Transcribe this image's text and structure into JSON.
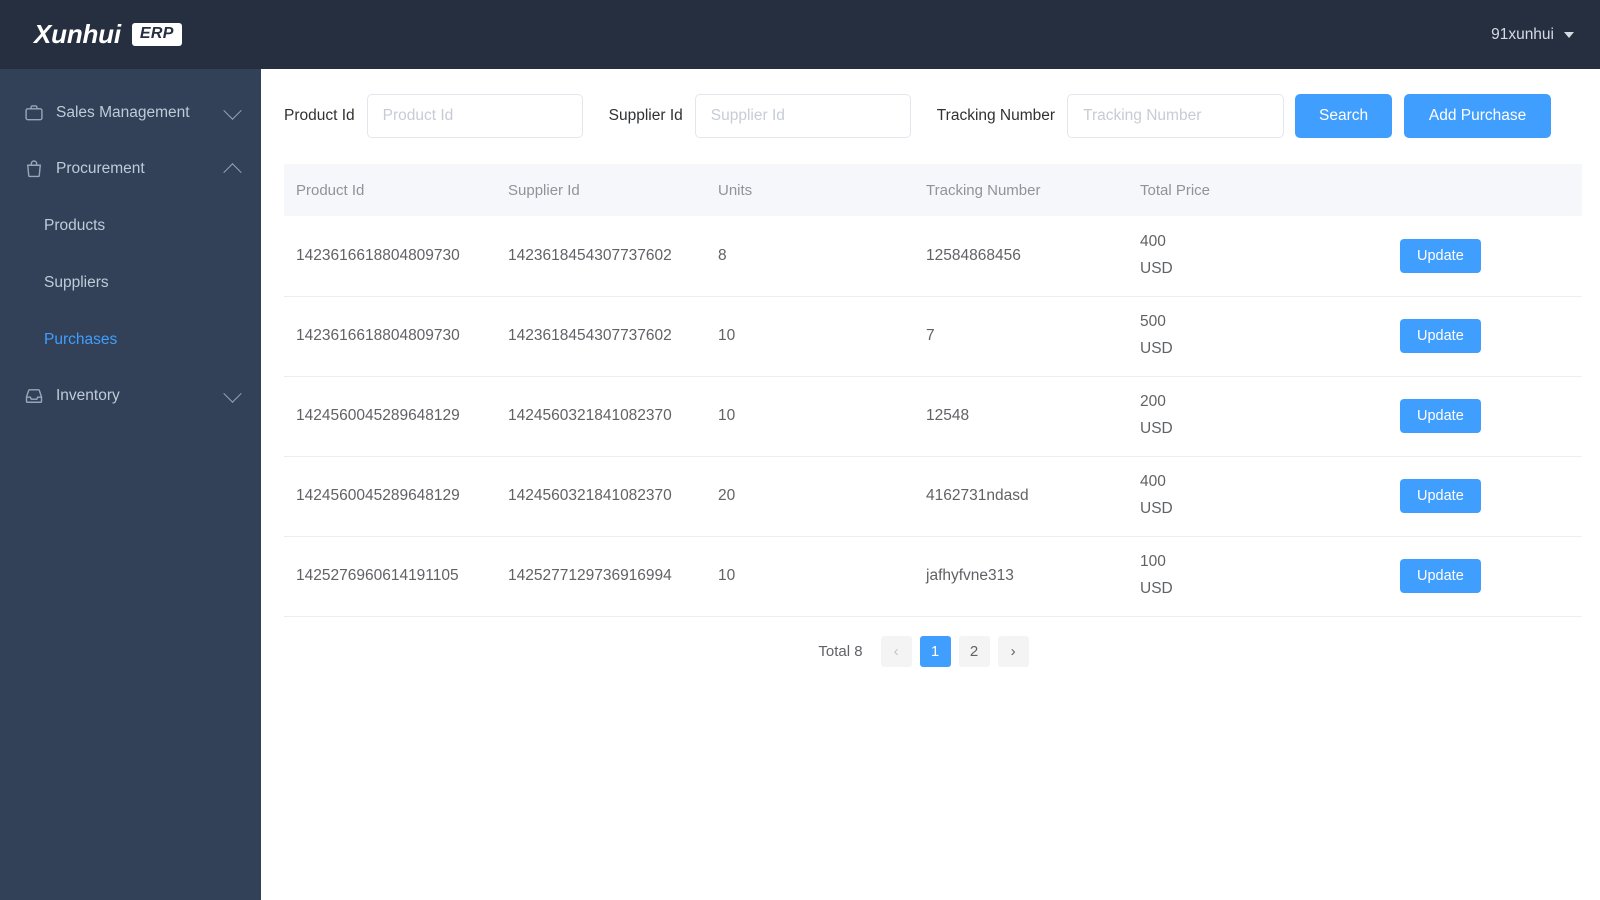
{
  "app": {
    "brand_name": "Xunhui",
    "brand_badge": "ERP",
    "accent_color": "#409eff",
    "topbar_color": "#262f40",
    "sidebar_color": "#324157"
  },
  "header": {
    "user_name": "91xunhui"
  },
  "sidebar": {
    "groups": [
      {
        "label": "Sales Management",
        "icon": "briefcase-icon",
        "expanded": false,
        "chevron": "chevron-down-icon"
      },
      {
        "label": "Procurement",
        "icon": "shopping-bag-icon",
        "expanded": true,
        "chevron": "chevron-up-icon"
      },
      {
        "label": "Inventory",
        "icon": "inbox-icon",
        "expanded": false,
        "chevron": "chevron-down-icon"
      }
    ],
    "procurement_items": [
      {
        "label": "Products",
        "active": false
      },
      {
        "label": "Suppliers",
        "active": false
      },
      {
        "label": "Purchases",
        "active": true
      }
    ]
  },
  "toolbar": {
    "product_id_label": "Product Id",
    "product_id_placeholder": "Product Id",
    "product_id_value": "",
    "supplier_id_label": "Supplier Id",
    "supplier_id_placeholder": "Supplier Id",
    "supplier_id_value": "",
    "tracking_number_label": "Tracking Number",
    "tracking_number_placeholder": "Tracking Number",
    "tracking_number_value": "",
    "search_label": "Search",
    "add_purchase_label": "Add Purchase"
  },
  "table": {
    "columns": [
      "Product Id",
      "Supplier Id",
      "Units",
      "Tracking Number",
      "Total Price"
    ],
    "action_label": "Update",
    "rows": [
      {
        "product_id": "1423616618804809730",
        "supplier_id": "1423618454307737602",
        "units": "8",
        "tracking_number": "12584868456",
        "price_amount": "400",
        "price_currency": "USD",
        "action": "Update"
      },
      {
        "product_id": "1423616618804809730",
        "supplier_id": "1423618454307737602",
        "units": "10",
        "tracking_number": "7",
        "price_amount": "500",
        "price_currency": "USD",
        "action": "Update"
      },
      {
        "product_id": "1424560045289648129",
        "supplier_id": "1424560321841082370",
        "units": "10",
        "tracking_number": "12548",
        "price_amount": "200",
        "price_currency": "USD",
        "action": "Update"
      },
      {
        "product_id": "1424560045289648129",
        "supplier_id": "1424560321841082370",
        "units": "20",
        "tracking_number": "4162731ndasd",
        "price_amount": "400",
        "price_currency": "USD",
        "action": "Update"
      },
      {
        "product_id": "1425276960614191105",
        "supplier_id": "1425277129736916994",
        "units": "10",
        "tracking_number": "jafhyfvne313",
        "price_amount": "100",
        "price_currency": "USD",
        "action": "Update"
      }
    ]
  },
  "pagination": {
    "total_label": "Total 8",
    "prev_icon": "chevron-left-icon",
    "next_icon": "chevron-right-icon",
    "pages": [
      "1",
      "2"
    ],
    "current_page": "1"
  }
}
